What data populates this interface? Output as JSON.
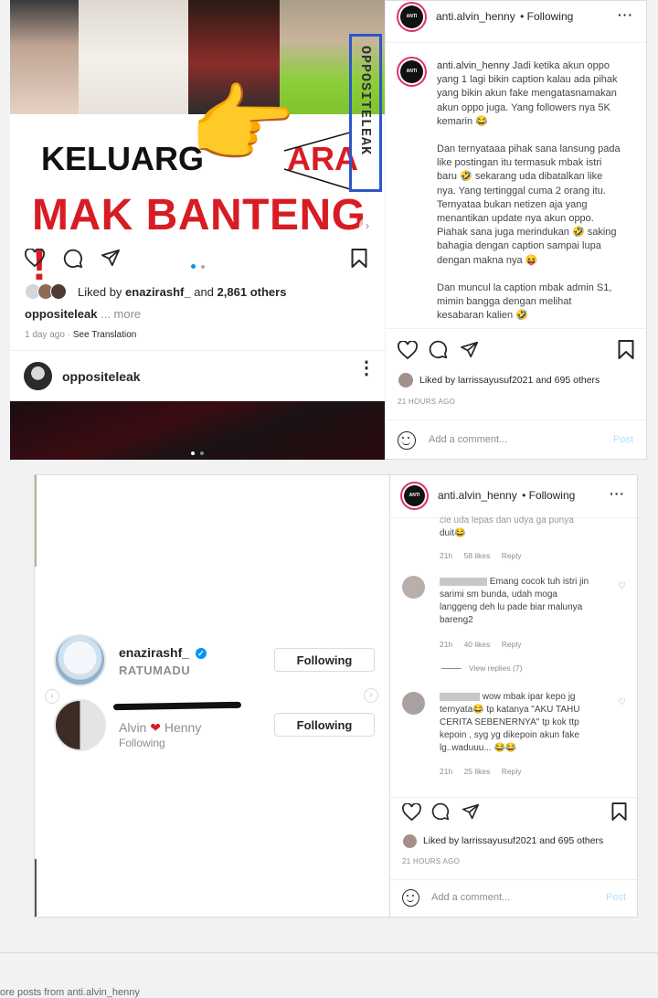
{
  "post1": {
    "banner": {
      "line1": "KELUARG",
      "line1_tail": "ARA",
      "line2": "MAK BANTENG !",
      "watermark": "OPPOSITELEAK"
    },
    "liked_by_prefix": "Liked by",
    "liked_by_user": "enazirashf_",
    "liked_by_and": "and",
    "liked_by_count": "2,861 others",
    "caption_user": "oppositeleak",
    "caption_more": "... more",
    "time": "1 day ago",
    "see_translation": "See Translation",
    "next_user": "oppositeleak"
  },
  "panel1": {
    "username": "anti.alvin_henny",
    "follow_status": "• Following",
    "caption_user": "anti.alvin_henny",
    "caption_lines": [
      "Jadi ketika akun oppo",
      "yang 1 lagi bikin caption kalau ada pihak",
      "yang bikin akun fake mengatasnamakan",
      "akun oppo juga. Yang followers nya 5K",
      "kemarin 😂",
      "",
      "Dan ternyataaa pihak sana lansung pada",
      "like postingan itu termasuk mbak istri",
      "baru 🤣 sekarang uda dibatalkan like",
      "nya. Yang tertinggal cuma 2 orang itu.",
      "Ternyataa bukan netizen aja yang",
      "menantikan update nya akun oppo.",
      "Piahak sana juga merindukan 🤣 saking",
      "bahagia dengan caption sampai lupa",
      "dengan makna nya 😝",
      "",
      "Dan muncul la caption mbak admin S1,",
      "mimin bangga dengan melihat",
      "kesabaran kalien 🤣"
    ],
    "liked_by": "Liked by",
    "liked_by_user": "larrissayusuf2021",
    "liked_by_rest": "and 695 others",
    "timestamp": "21 HOURS AGO",
    "comment_placeholder": "Add a comment...",
    "post_label": "Post"
  },
  "panel2": {
    "username": "anti.alvin_henny",
    "follow_status": "• Following",
    "comments": [
      {
        "text_lines": [
          "cie uda lepas dan udya ga punya",
          "duit😂"
        ],
        "time": "21h",
        "likes": "58 likes",
        "reply": "Reply"
      },
      {
        "text_lines": [
          "Emang cocok tuh istri jin",
          "sarimi sm bunda, udah moga",
          "langgeng deh lu pade biar malunya",
          "bareng2"
        ],
        "time": "21h",
        "likes": "40 likes",
        "reply": "Reply",
        "view_replies": "View replies (7)"
      },
      {
        "text_lines": [
          "wow mbak ipar kepo jg",
          "ternyata😂 tp katanya \"AKU TAHU",
          "CERITA SEBENERNYA\" tp kok ttp",
          "kepoin , syg yg dikepoin akun fake",
          "lg..waduuu... 😂😂"
        ],
        "time": "21h",
        "likes": "25 likes",
        "reply": "Reply"
      }
    ],
    "liked_by": "Liked by",
    "liked_by_user": "larrissayusuf2021",
    "liked_by_rest": "and 695 others",
    "timestamp": "21 HOURS AGO",
    "comment_placeholder": "Add a comment...",
    "post_label": "Post"
  },
  "suggestions": [
    {
      "name": "enazirashf_",
      "sub": "RATUMADU",
      "button": "Following"
    },
    {
      "name_left": "Alvin",
      "name_right": "Henny",
      "sub": "Following",
      "button": "Following"
    }
  ],
  "footer": {
    "more_posts": "ore posts from anti.alvin_henny"
  },
  "colors": {
    "accent_red": "#d71c24",
    "ig_blue": "#0095f6",
    "post_disabled": "#b2dffc",
    "verified": "#0095f6"
  }
}
